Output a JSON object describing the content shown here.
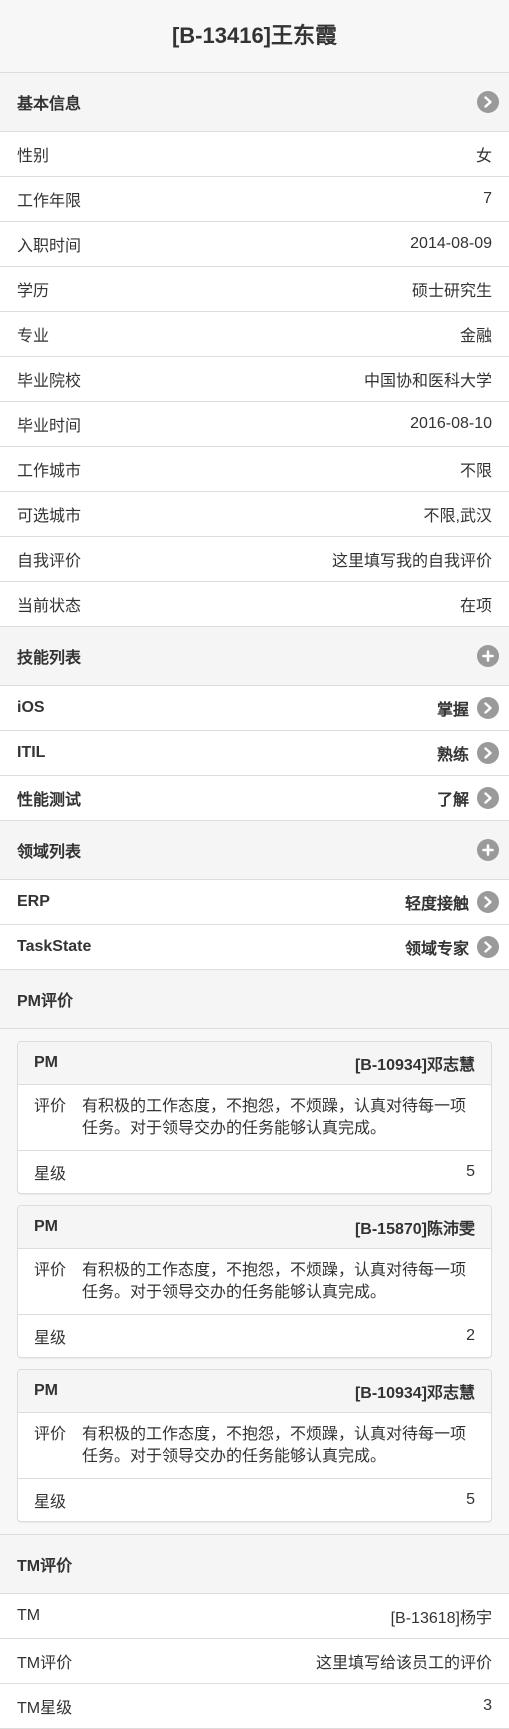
{
  "page_title": "[B-13416]王东霞",
  "basic": {
    "header": "基本信息",
    "rows": [
      {
        "label": "性别",
        "value": "女"
      },
      {
        "label": "工作年限",
        "value": "7"
      },
      {
        "label": "入职时间",
        "value": "2014-08-09"
      },
      {
        "label": "学历",
        "value": "硕士研究生"
      },
      {
        "label": "专业",
        "value": "金融"
      },
      {
        "label": "毕业院校",
        "value": "中国协和医科大学"
      },
      {
        "label": "毕业时间",
        "value": "2016-08-10"
      },
      {
        "label": "工作城市",
        "value": "不限"
      },
      {
        "label": "可选城市",
        "value": "不限,武汉"
      },
      {
        "label": "自我评价",
        "value": "这里填写我的自我评价"
      },
      {
        "label": "当前状态",
        "value": "在项"
      }
    ]
  },
  "skills": {
    "header": "技能列表",
    "items": [
      {
        "name": "iOS",
        "level": "掌握"
      },
      {
        "name": "ITIL",
        "level": "熟练"
      },
      {
        "name": "性能测试",
        "level": "了解"
      }
    ]
  },
  "domains": {
    "header": "领域列表",
    "items": [
      {
        "name": "ERP",
        "level": "轻度接触"
      },
      {
        "name": "TaskState",
        "level": "领域专家"
      }
    ]
  },
  "pm_reviews": {
    "header": "PM评价",
    "cards": [
      {
        "role": "PM",
        "reviewer": "[B-10934]邓志慧",
        "eval_label": "评价",
        "eval_text": "有积极的工作态度，不抱怨，不烦躁，认真对待每一项任务。对于领导交办的任务能够认真完成。",
        "star_label": "星级",
        "stars": "5"
      },
      {
        "role": "PM",
        "reviewer": "[B-15870]陈沛雯",
        "eval_label": "评价",
        "eval_text": "有积极的工作态度，不抱怨，不烦躁，认真对待每一项任务。对于领导交办的任务能够认真完成。",
        "star_label": "星级",
        "stars": "2"
      },
      {
        "role": "PM",
        "reviewer": "[B-10934]邓志慧",
        "eval_label": "评价",
        "eval_text": "有积极的工作态度，不抱怨，不烦躁，认真对待每一项任务。对于领导交办的任务能够认真完成。",
        "star_label": "星级",
        "stars": "5"
      }
    ]
  },
  "tm_review": {
    "header": "TM评价",
    "rows": [
      {
        "label": "TM",
        "value": "[B-13618]杨宇"
      },
      {
        "label": "TM评价",
        "value": "这里填写给该员工的评价"
      },
      {
        "label": "TM星级",
        "value": "3"
      }
    ]
  },
  "icons": {
    "basic_header": "chevron-right-icon",
    "skills_header": "plus-icon",
    "domains_header": "plus-icon",
    "row_action": "chevron-right-icon"
  },
  "colors": {
    "icon_bg": "#9a9a9a",
    "header_bg": "#f5f5f5",
    "border": "#dddddd"
  }
}
